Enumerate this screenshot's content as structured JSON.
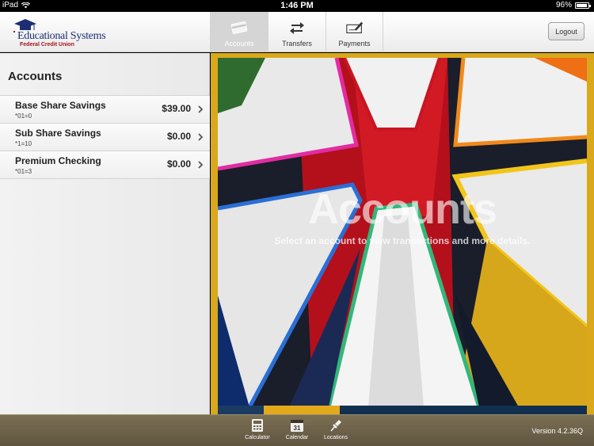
{
  "status": {
    "device": "iPad",
    "time": "1:46 PM",
    "battery": "96%",
    "battery_level": 0.96
  },
  "header": {
    "logo_line1": "Educational Systems",
    "logo_line2": "Federal Credit Union",
    "tabs": [
      {
        "label": "Accounts",
        "icon": "accounts-card-icon",
        "active": true
      },
      {
        "label": "Transfers",
        "icon": "transfer-arrows-icon",
        "active": false
      },
      {
        "label": "Payments",
        "icon": "payment-check-icon",
        "active": false
      }
    ],
    "logout_label": "Logout"
  },
  "sidebar": {
    "title": "Accounts",
    "accounts": [
      {
        "name": "Base Share Savings",
        "number": "*01=0",
        "balance": "$39.00"
      },
      {
        "name": "Sub Share Savings",
        "number": "*1=10",
        "balance": "$0.00"
      },
      {
        "name": "Premium Checking",
        "number": "*01=3",
        "balance": "$0.00"
      }
    ]
  },
  "main": {
    "overlay_title": "Accounts",
    "overlay_subtitle": "Select an account to view transactions and more details.",
    "strip_colors": [
      "#1b3b62",
      "#e2a91a",
      "#11304f"
    ]
  },
  "colors": {
    "accent_gold": "#d9a91b",
    "toolbar": "#6e6349",
    "brand_blue": "#1c2f73",
    "brand_red": "#a3121d"
  },
  "toolbar": {
    "items": [
      {
        "label": "Calculator",
        "icon": "calculator-icon"
      },
      {
        "label": "Calendar",
        "icon": "calendar-icon",
        "badge": "31"
      },
      {
        "label": "Locations",
        "icon": "map-pin-icon"
      }
    ],
    "version": "Version 4.2.36Q"
  }
}
